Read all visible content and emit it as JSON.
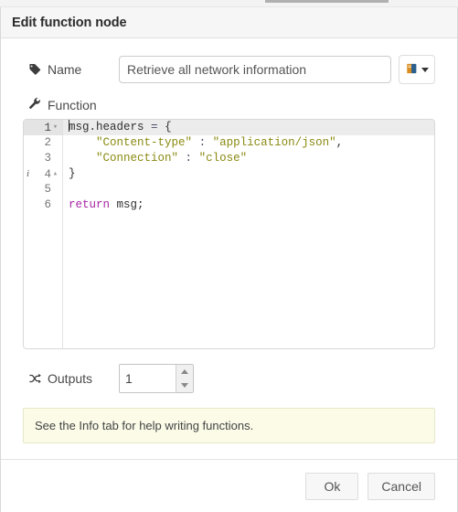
{
  "window": {
    "top_strip_present": true
  },
  "dialog": {
    "title": "Edit function node"
  },
  "form": {
    "name": {
      "label": "Name",
      "icon": "tag-icon",
      "value": "Retrieve all network information",
      "placeholder": "Name"
    },
    "library_button": {
      "icon": "book-icon",
      "caret": "chevron-down-icon"
    },
    "function": {
      "label": "Function",
      "icon": "wrench-icon"
    },
    "outputs": {
      "label": "Outputs",
      "icon": "shuffle-icon",
      "value": "1"
    }
  },
  "editor": {
    "active_line": 1,
    "lines": [
      {
        "number": "1",
        "fold": "open",
        "annotation": "",
        "tokens": [
          {
            "t": "msg.headers",
            "c": "tk-pl"
          },
          {
            "t": " ",
            "c": "tk-pl"
          },
          {
            "t": "=",
            "c": "tk-op"
          },
          {
            "t": " ",
            "c": "tk-pl"
          },
          {
            "t": "{",
            "c": "tk-pl"
          }
        ]
      },
      {
        "number": "2",
        "fold": "",
        "annotation": "",
        "tokens": [
          {
            "t": "    ",
            "c": "tk-pl"
          },
          {
            "t": "\"Content-type\"",
            "c": "tk-str"
          },
          {
            "t": " ",
            "c": "tk-pl"
          },
          {
            "t": ":",
            "c": "tk-op"
          },
          {
            "t": " ",
            "c": "tk-pl"
          },
          {
            "t": "\"application/json\"",
            "c": "tk-str"
          },
          {
            "t": ",",
            "c": "tk-pl"
          }
        ]
      },
      {
        "number": "3",
        "fold": "",
        "annotation": "",
        "tokens": [
          {
            "t": "    ",
            "c": "tk-pl"
          },
          {
            "t": "\"Connection\"",
            "c": "tk-str"
          },
          {
            "t": " ",
            "c": "tk-pl"
          },
          {
            "t": ":",
            "c": "tk-op"
          },
          {
            "t": " ",
            "c": "tk-pl"
          },
          {
            "t": "\"close\"",
            "c": "tk-str"
          }
        ]
      },
      {
        "number": "4",
        "fold": "close",
        "annotation": "i",
        "tokens": [
          {
            "t": "}",
            "c": "tk-pl"
          }
        ]
      },
      {
        "number": "5",
        "fold": "",
        "annotation": "",
        "tokens": []
      },
      {
        "number": "6",
        "fold": "",
        "annotation": "",
        "tokens": [
          {
            "t": "return",
            "c": "tk-kw"
          },
          {
            "t": " msg;",
            "c": "tk-pl"
          }
        ]
      }
    ]
  },
  "notice": {
    "text": "See the Info tab for help writing functions."
  },
  "footer": {
    "ok_label": "Ok",
    "cancel_label": "Cancel"
  },
  "colors": {
    "header_bg": "#f6f6f6",
    "notice_bg": "#fbfbe8",
    "notice_border": "#e7e7c8",
    "string_token": "#8a8a12",
    "keyword_token": "#a626a4",
    "active_line": "#ececec"
  }
}
